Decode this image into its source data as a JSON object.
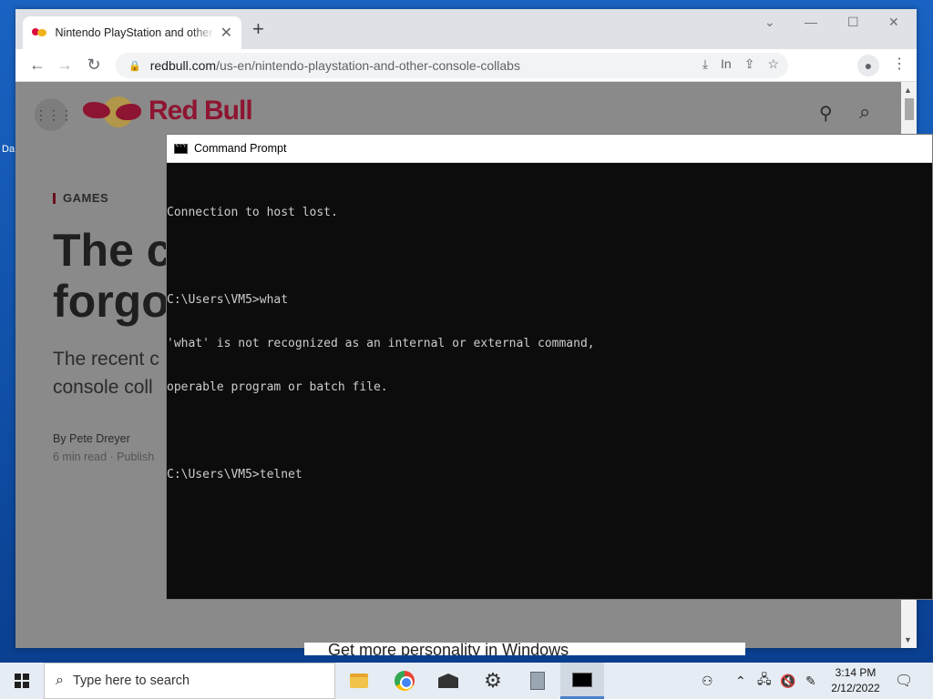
{
  "desktop": {
    "icon_label": "Da"
  },
  "browser": {
    "tab_title": "Nintendo PlayStation and other c",
    "url_host": "redbull.com",
    "url_path": "/us-en/nintendo-playstation-and-other-console-collabs",
    "omnibox_extra": "In"
  },
  "page": {
    "brand": "Red Bull",
    "category": "GAMES",
    "headline": [
      "The c",
      "forgo"
    ],
    "subhead": [
      "The recent c",
      "console coll"
    ],
    "byline": "By Pete Dreyer",
    "meta": "6 min read · Publish",
    "personality_banner": "Get more personality in Windows"
  },
  "cmd": {
    "title": "Command Prompt",
    "lines": [
      "Connection to host lost.",
      "",
      "C:\\Users\\VM5>what",
      "'what' is not recognized as an internal or external command,",
      "operable program or batch file.",
      "",
      "C:\\Users\\VM5>telnet"
    ]
  },
  "taskbar": {
    "search_placeholder": "Type here to search",
    "time": "3:14 PM",
    "date": "2/12/2022"
  }
}
